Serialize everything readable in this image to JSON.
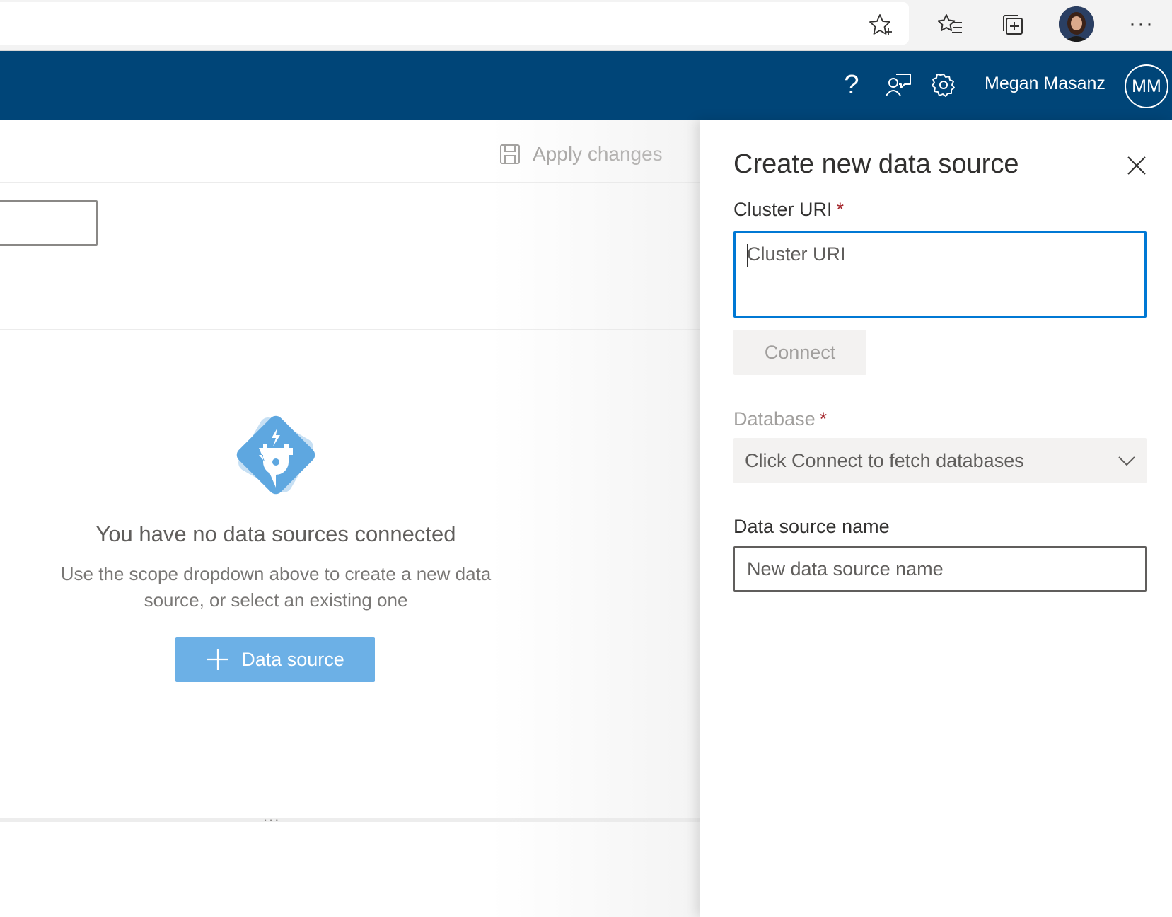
{
  "browser": {
    "icons": [
      "add-favorite-star-icon",
      "favorites-icon",
      "collections-icon",
      "profile-avatar",
      "more-icon"
    ],
    "more_label": "···"
  },
  "header": {
    "background": "#004578",
    "icons": [
      "help-icon",
      "feedback-icon",
      "settings-icon"
    ],
    "help_label": "?",
    "user_name": "Megan Masanz",
    "user_initials": "MM"
  },
  "toolbar": {
    "apply_label": "Apply changes"
  },
  "empty_state": {
    "title": "You have no data sources connected",
    "description": "Use the scope dropdown above to create a new data source, or select an existing one",
    "add_button_label": "Data source"
  },
  "splitter": {
    "dots": "..."
  },
  "panel": {
    "title": "Create new data source",
    "cluster_uri": {
      "label": "Cluster URI",
      "required_mark": "*",
      "placeholder": "Cluster URI",
      "value": ""
    },
    "connect_label": "Connect",
    "database": {
      "label": "Database",
      "required_mark": "*",
      "placeholder": "Click Connect to fetch databases"
    },
    "data_source_name": {
      "label": "Data source name",
      "placeholder": "New data source name"
    }
  },
  "colors": {
    "accent": "#0078d4",
    "header": "#004578",
    "primary_button": "#6cb0e6",
    "required": "#a4262c"
  }
}
